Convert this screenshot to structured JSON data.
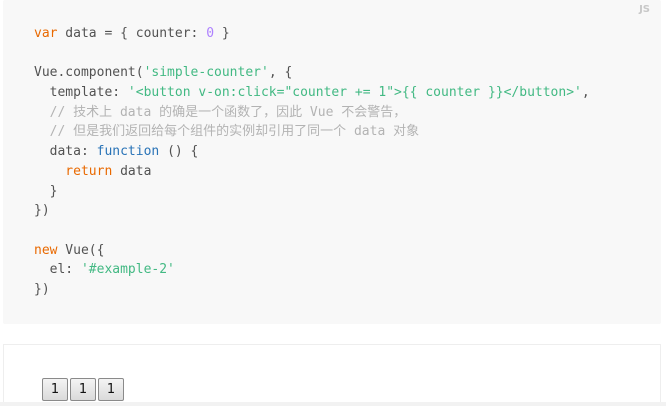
{
  "code_block": {
    "language_label": "JS",
    "lines": [
      [
        {
          "t": "kw",
          "v": "var"
        },
        {
          "t": "txt",
          "v": " data = { counter: "
        },
        {
          "t": "num",
          "v": "0"
        },
        {
          "t": "txt",
          "v": " }"
        }
      ],
      [],
      [
        {
          "t": "txt",
          "v": "Vue.component("
        },
        {
          "t": "str",
          "v": "'simple-counter'"
        },
        {
          "t": "txt",
          "v": ", {"
        }
      ],
      [
        {
          "t": "txt",
          "v": "  template: "
        },
        {
          "t": "str",
          "v": "'<button v-on:click=\"counter += 1\">{{ counter }}</button>'"
        },
        {
          "t": "txt",
          "v": ","
        }
      ],
      [
        {
          "t": "com",
          "v": "  // 技术上 data 的确是一个函数了，因此 Vue 不会警告，"
        }
      ],
      [
        {
          "t": "com",
          "v": "  // 但是我们返回给每个组件的实例却引用了同一个 data 对象"
        }
      ],
      [
        {
          "t": "txt",
          "v": "  data: "
        },
        {
          "t": "fn",
          "v": "function"
        },
        {
          "t": "txt",
          "v": " () {"
        }
      ],
      [
        {
          "t": "kw",
          "v": "    return"
        },
        {
          "t": "txt",
          "v": " data"
        }
      ],
      [
        {
          "t": "txt",
          "v": "  }"
        }
      ],
      [
        {
          "t": "txt",
          "v": "})"
        }
      ],
      [],
      [
        {
          "t": "kw",
          "v": "new"
        },
        {
          "t": "txt",
          "v": " Vue({"
        }
      ],
      [
        {
          "t": "txt",
          "v": "  el: "
        },
        {
          "t": "str",
          "v": "'#example-2'"
        }
      ],
      [
        {
          "t": "txt",
          "v": "})"
        }
      ]
    ]
  },
  "demo": {
    "buttons": [
      {
        "label": "1"
      },
      {
        "label": "1"
      },
      {
        "label": "1"
      }
    ]
  },
  "colors": {
    "keyword": "#e96900",
    "string": "#42b983",
    "number": "#ae81ff",
    "comment": "#b3b3b3",
    "function_keyword": "#2973b7",
    "code_background": "#f8f8f8"
  }
}
